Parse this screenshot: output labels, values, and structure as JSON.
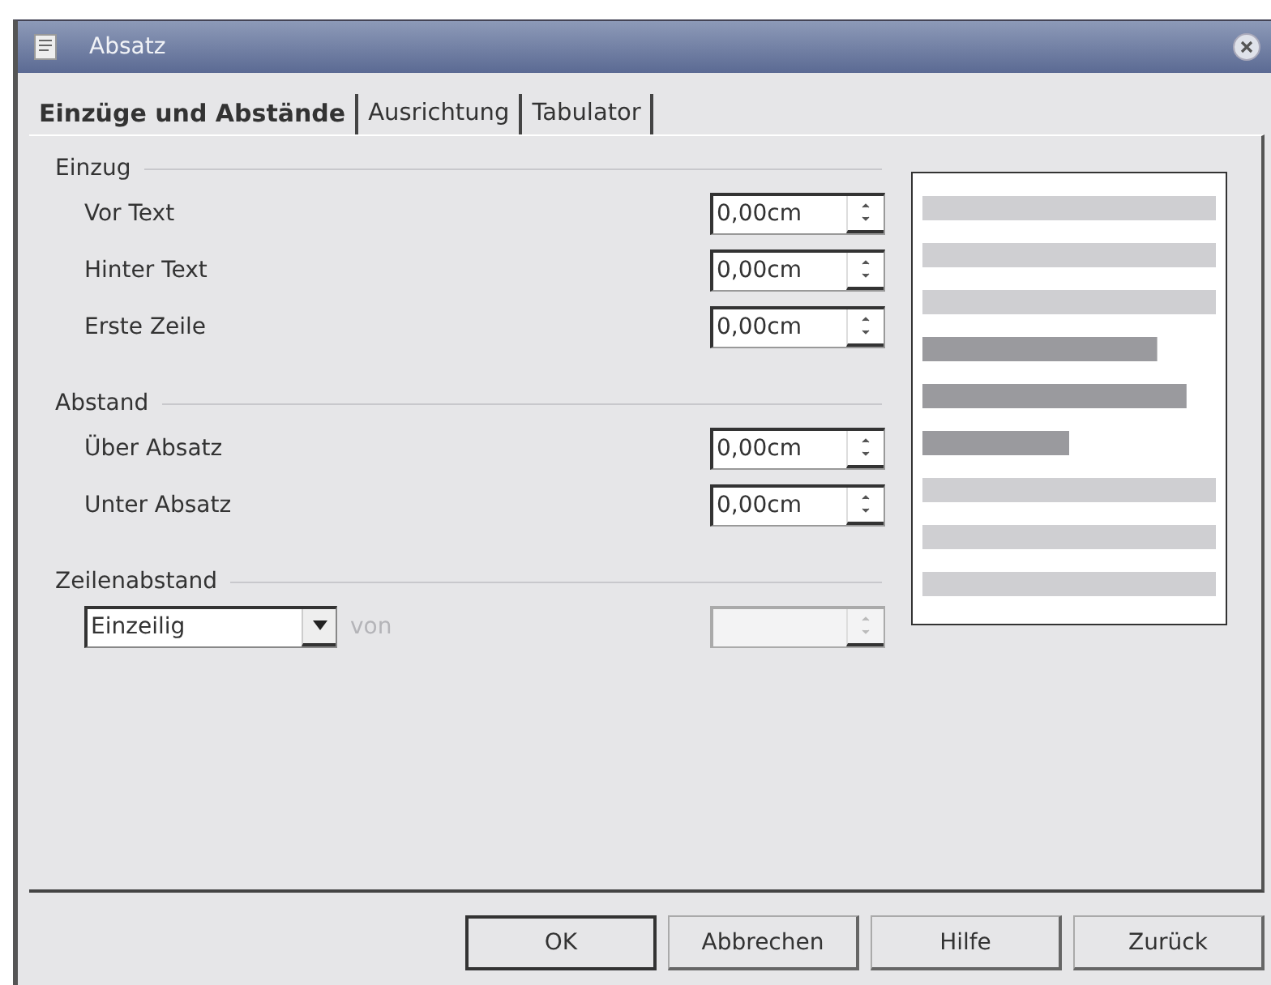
{
  "window": {
    "title": "Absatz"
  },
  "tabs": [
    {
      "label": "Einzüge und Abstände",
      "selected": true
    },
    {
      "label": "Ausrichtung",
      "selected": false
    },
    {
      "label": "Tabulator",
      "selected": false
    }
  ],
  "sections": [
    {
      "title": "Einzug",
      "rows": [
        {
          "label": "Vor Text",
          "value": "0,00cm"
        },
        {
          "label": "Hinter Text",
          "value": "0,00cm"
        },
        {
          "label": "Erste Zeile",
          "value": "0,00cm"
        }
      ]
    },
    {
      "title": "Abstand",
      "rows": [
        {
          "label": "Über Absatz",
          "value": "0,00cm"
        },
        {
          "label": "Unter Absatz",
          "value": "0,00cm"
        }
      ]
    }
  ],
  "line_spacing": {
    "title": "Zeilenabstand",
    "dropdown": "Einzeilig",
    "of_label": "von",
    "of_disabled": true
  },
  "buttons": [
    {
      "label": "OK",
      "default": true
    },
    {
      "label": "Abbrechen",
      "default": false
    },
    {
      "label": "Hilfe",
      "default": false
    },
    {
      "label": "Zurück",
      "default": false
    }
  ]
}
